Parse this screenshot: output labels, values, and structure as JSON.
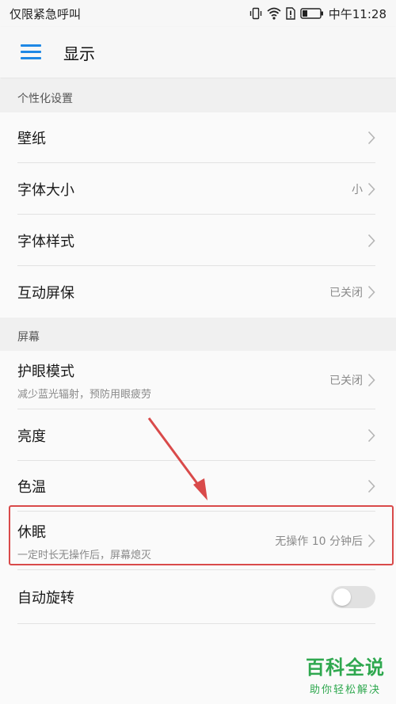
{
  "status_bar": {
    "carrier_text": "仅限紧急呼叫",
    "time": "中午11:28",
    "icons": [
      "vibrate-icon",
      "wifi-icon",
      "sim-alert-icon",
      "battery-icon"
    ]
  },
  "app_bar": {
    "title": "显示",
    "menu_icon": "hamburger-menu-icon",
    "accent_color": "#1e88e5"
  },
  "sections": {
    "personalization": {
      "header": "个性化设置",
      "items": {
        "wallpaper": {
          "title": "壁纸"
        },
        "font_size": {
          "title": "字体大小",
          "value": "小"
        },
        "font_style": {
          "title": "字体样式"
        },
        "screensaver": {
          "title": "互动屏保",
          "value": "已关闭"
        }
      }
    },
    "screen": {
      "header": "屏幕",
      "items": {
        "eye_comfort": {
          "title": "护眼模式",
          "subtitle": "减少蓝光辐射，预防用眼疲劳",
          "value": "已关闭"
        },
        "brightness": {
          "title": "亮度"
        },
        "color_temp": {
          "title": "色温"
        },
        "sleep": {
          "title": "休眠",
          "subtitle": "一定时长无操作后，屏幕熄灭",
          "value": "无操作 10 分钟后"
        },
        "auto_rotate": {
          "title": "自动旋转",
          "toggle_on": false
        }
      }
    }
  },
  "annotation": {
    "highlight_color": "#d94a4a"
  },
  "watermark": {
    "main": "百科全说",
    "sub": "助你轻松解决",
    "color": "#2fa84f"
  }
}
